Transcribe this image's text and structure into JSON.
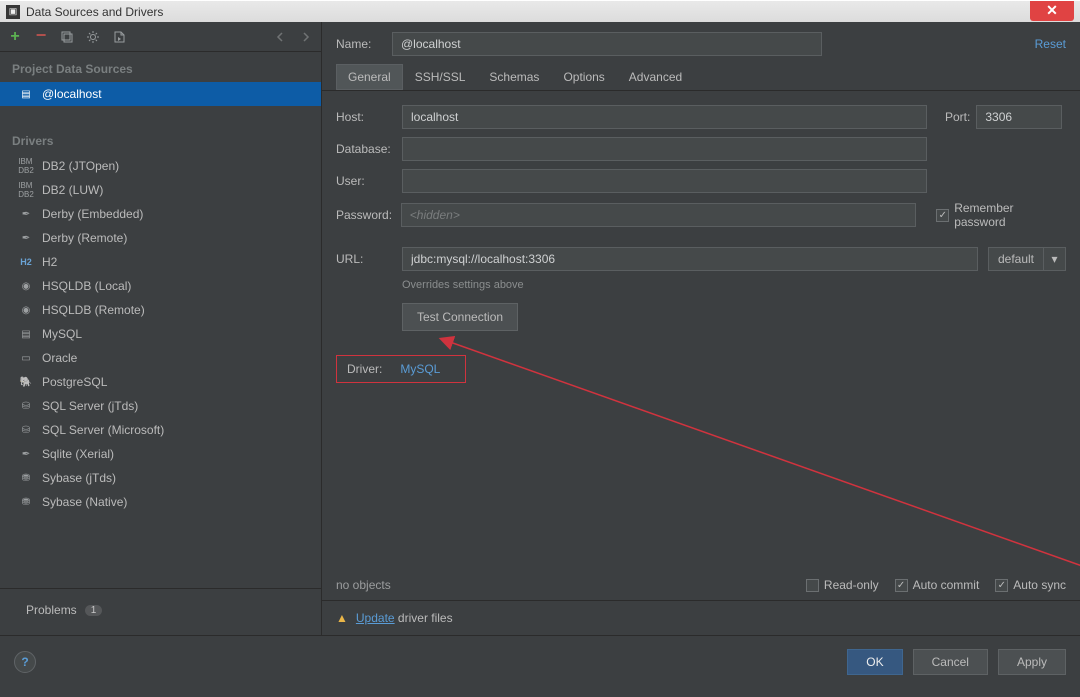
{
  "window": {
    "title": "Data Sources and Drivers"
  },
  "toolbar": {
    "add": "+",
    "remove": "−"
  },
  "sidebar": {
    "project_header": "Project Data Sources",
    "source_item": "@localhost",
    "drivers_header": "Drivers",
    "drivers": [
      {
        "label": "DB2 (JTOpen)"
      },
      {
        "label": "DB2 (LUW)"
      },
      {
        "label": "Derby (Embedded)"
      },
      {
        "label": "Derby (Remote)"
      },
      {
        "label": "H2"
      },
      {
        "label": "HSQLDB (Local)"
      },
      {
        "label": "HSQLDB (Remote)"
      },
      {
        "label": "MySQL"
      },
      {
        "label": "Oracle"
      },
      {
        "label": "PostgreSQL"
      },
      {
        "label": "SQL Server (jTds)"
      },
      {
        "label": "SQL Server (Microsoft)"
      },
      {
        "label": "Sqlite (Xerial)"
      },
      {
        "label": "Sybase (jTds)"
      },
      {
        "label": "Sybase (Native)"
      }
    ],
    "problems_label": "Problems",
    "problems_count": "1"
  },
  "main": {
    "name_label": "Name:",
    "name_value": "@localhost",
    "reset": "Reset",
    "tabs": [
      {
        "label": "General",
        "active": true
      },
      {
        "label": "SSH/SSL",
        "active": false
      },
      {
        "label": "Schemas",
        "active": false
      },
      {
        "label": "Options",
        "active": false
      },
      {
        "label": "Advanced",
        "active": false
      }
    ],
    "host_label": "Host:",
    "host_value": "localhost",
    "port_label": "Port:",
    "port_value": "3306",
    "database_label": "Database:",
    "database_value": "",
    "user_label": "User:",
    "user_value": "",
    "password_label": "Password:",
    "password_placeholder": "<hidden>",
    "remember_label": "Remember password",
    "url_label": "URL:",
    "url_value": "jdbc:mysql://localhost:3306",
    "url_default": "default",
    "overrides_note": "Overrides settings above",
    "test_btn": "Test Connection",
    "driver_label": "Driver:",
    "driver_link": "MySQL",
    "no_objects": "no objects",
    "readonly_label": "Read-only",
    "autocommit_label": "Auto commit",
    "autosync_label": "Auto sync",
    "update_link": "Update",
    "update_rest": " driver files"
  },
  "footer": {
    "ok": "OK",
    "cancel": "Cancel",
    "apply": "Apply"
  }
}
